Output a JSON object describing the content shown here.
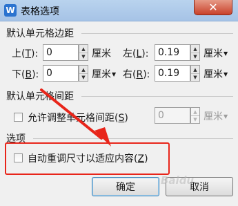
{
  "window": {
    "icon": "W",
    "title": "表格选项",
    "close_glyph": "✕"
  },
  "margins": {
    "title": "默认单元格边距",
    "top": {
      "label": "上(",
      "key": "T",
      "close": "):",
      "value": "0",
      "unit": "厘米"
    },
    "left": {
      "label": "左(",
      "key": "L",
      "close": "):",
      "value": "0.19",
      "unit": "厘米"
    },
    "bottom": {
      "label": "下(",
      "key": "B",
      "close": "):",
      "value": "0",
      "unit": "厘米"
    },
    "right": {
      "label": "右(",
      "key": "R",
      "close": "):",
      "value": "0.19",
      "unit": "厘米"
    }
  },
  "spacing": {
    "title": "默认单元格间距",
    "checkbox": {
      "label": "允许调整单元格间距(",
      "key": "S",
      "close": ")",
      "checked": false
    },
    "value": "0",
    "unit": "厘米"
  },
  "options": {
    "title": "选项",
    "autofit": {
      "label": "自动重调尺寸以适应内容(",
      "key": "Z",
      "close": ")",
      "checked": false
    }
  },
  "buttons": {
    "ok": "确定",
    "cancel": "取消"
  },
  "watermark": "Baidu"
}
